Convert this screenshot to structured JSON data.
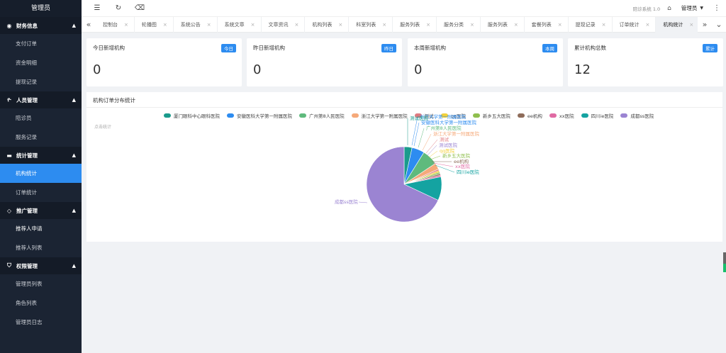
{
  "sidebar": {
    "title": "管理员",
    "groups": [
      {
        "label": "财务信息",
        "icon": "radio-icon",
        "items": [
          "支付订单",
          "资金明细",
          "提现记录"
        ]
      },
      {
        "label": "人员管理",
        "icon": "person-icon",
        "items": [
          "陪诊员",
          "服务记录"
        ]
      },
      {
        "label": "统计管理",
        "icon": "folder-icon",
        "items": [
          "机构统计",
          "订单统计"
        ]
      },
      {
        "label": "推广管理",
        "icon": "diamond-icon",
        "items": [
          "推荐人申请",
          "推荐人列表"
        ]
      },
      {
        "label": "权限管理",
        "icon": "shield-icon",
        "items": [
          "管理员列表",
          "角色列表",
          "管理员日志"
        ]
      }
    ],
    "active_item": "机构统计"
  },
  "topbar": {
    "system_name": "陪诊系统 1.0",
    "user": "管理员",
    "icons": [
      "menu-toggle-icon",
      "refresh-icon",
      "broom-icon",
      "tag-icon",
      "caret-down-icon",
      "more-vertical-icon"
    ]
  },
  "tabs": {
    "items": [
      "控制台",
      "轮播图",
      "系统公告",
      "系统文章",
      "文章资讯",
      "机构列表",
      "科室列表",
      "服务列表",
      "服务分类",
      "服务列表",
      "套餐列表",
      "提现记录",
      "订单统计",
      "机构统计"
    ],
    "active": "机构统计",
    "close_glyph": "×"
  },
  "cards": [
    {
      "title": "今日新增机构",
      "badge": "今日",
      "value": "0"
    },
    {
      "title": "昨日新增机构",
      "badge": "昨日",
      "value": "0"
    },
    {
      "title": "本周新增机构",
      "badge": "本周",
      "value": "0"
    },
    {
      "title": "累计机构总数",
      "badge": "累计",
      "value": "12"
    }
  ],
  "chart_panel": {
    "title": "机构订单分布统计",
    "hint": "点击统计"
  },
  "chart_data": {
    "type": "pie",
    "series": [
      {
        "name": "厦门眼科中心眼科医院",
        "value": 5,
        "color": "#1a9b8c"
      },
      {
        "name": "安徽医科大学第一附属医院",
        "value": 8,
        "color": "#2d8cf0"
      },
      {
        "name": "广州第8人民医院",
        "value": 10,
        "color": "#5fba7d"
      },
      {
        "name": "浙江大学第一附属医院",
        "value": 4,
        "color": "#f5a97a"
      },
      {
        "name": "测试",
        "value": 1,
        "color": "#e07a80"
      },
      {
        "name": "qq医院",
        "value": 1,
        "color": "#f2d03b"
      },
      {
        "name": "新乡五大医院",
        "value": 1,
        "color": "#8fbf4e"
      },
      {
        "name": "ee机构",
        "value": 1,
        "color": "#8e6c5a"
      },
      {
        "name": "xx医院",
        "value": 1,
        "color": "#e06aa3"
      },
      {
        "name": "四川ie医院",
        "value": 15,
        "color": "#14a3a1"
      },
      {
        "name": "成都ss医院",
        "value": 100,
        "color": "#9b84d2"
      }
    ],
    "label_texts": [
      "测试医院",
      "安徽医科大学第一附属医院",
      "广州第8人民医院",
      "浙江大学第一附属医院",
      "测试",
      "测试医院",
      "qq医院",
      "新乡五大医院",
      "ee机构",
      "xx医院",
      "四川ie医院",
      "成都ss医院",
      "测试医院测试医院",
      "q医院"
    ]
  }
}
